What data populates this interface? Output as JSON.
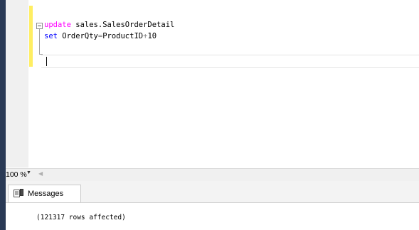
{
  "editor": {
    "line1_keyword": "update",
    "line1_rest": " sales.SalesOrderDetail",
    "line2_keyword": "set",
    "line2_col": " OrderQty",
    "line2_eq": "=",
    "line2_prod": "ProductID",
    "line2_plus": "+",
    "line2_num": "10"
  },
  "status": {
    "zoom": "100 %"
  },
  "results": {
    "tab_label": "Messages",
    "message": "(121317 rows affected)"
  },
  "colors": {
    "keyword_update": "#ff00ff",
    "keyword_set": "#0000ff",
    "operator": "#808080",
    "change_bar": "#ffee62",
    "window_edge": "#293955"
  },
  "icons": {
    "collapse": "collapse-box-icon",
    "zoom_dropdown": "chevron-down-icon",
    "scroll_left": "chevron-left-icon",
    "messages": "messages-icon"
  }
}
